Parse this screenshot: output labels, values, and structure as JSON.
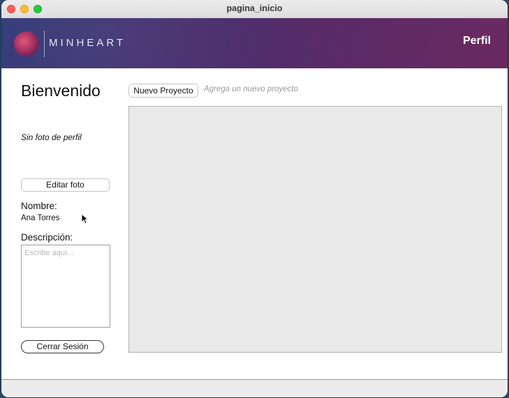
{
  "window": {
    "title": "pagina_inicio"
  },
  "header": {
    "brand": "MINHEART",
    "profile_link": "Perfil",
    "colors": {
      "banner_start": "#323a78",
      "banner_end": "#6a2a60",
      "logo_accent": "#e0587a"
    }
  },
  "sidebar": {
    "welcome": "Bienvenido",
    "no_photo": "Sin foto de perfil",
    "edit_photo_button": "Editar foto",
    "name_label": "Nombre:",
    "name_value": "Ana Torres",
    "description_label": "Descripción:",
    "description_placeholder": "Escribe aquí...",
    "description_value": "",
    "logout_button": "Cerrar Sesión"
  },
  "main": {
    "new_project_button": "Nuevo Proyecto",
    "new_project_hint": "Agrega un nuevo proyecto",
    "projects": []
  },
  "icons": {
    "traffic_lights": [
      "close-icon",
      "minimize-icon",
      "maximize-icon"
    ],
    "brand_logo": "orb-logo-icon",
    "cursor": "pointer-cursor-icon"
  }
}
